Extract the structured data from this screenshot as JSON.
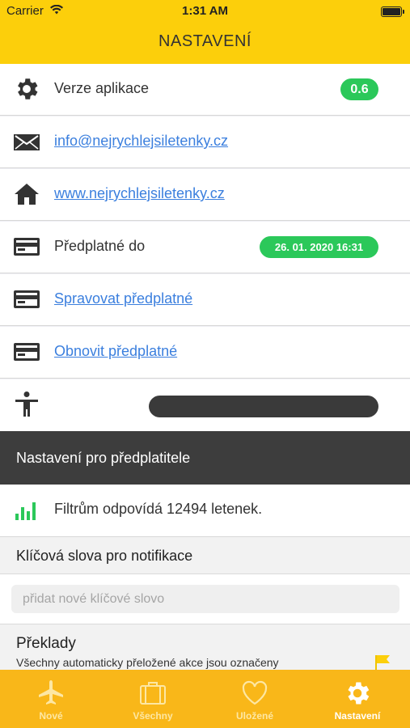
{
  "status_bar": {
    "carrier": "Carrier",
    "time": "1:31 AM"
  },
  "header": {
    "title": "NASTAVENÍ"
  },
  "settings": {
    "version_label": "Verze aplikace",
    "version_value": "0.6",
    "email": "info@nejrychlejsiletenky.cz",
    "website": "www.nejrychlejsiletenky.cz",
    "subscription_label": "Předplatné do",
    "subscription_value": "26. 01. 2020 16:31",
    "manage_subscription": "Spravovat předplatné",
    "restore_subscription": "Obnovit předplatné"
  },
  "subscriber_section": {
    "title": "Nastavení pro předplatitele"
  },
  "filters": {
    "text": "Filtrům odpovídá 12494 letenek."
  },
  "keywords": {
    "title": "Klíčová slova pro notifikace",
    "placeholder": "přidat nové klíčové slovo"
  },
  "translations": {
    "title": "Překlady",
    "description": "Všechny automaticky přeložené akce jsou označeny"
  },
  "tabs": [
    {
      "label": "Nové",
      "icon": "airplane-icon"
    },
    {
      "label": "Všechny",
      "icon": "suitcase-icon"
    },
    {
      "label": "Uložené",
      "icon": "heart-icon"
    },
    {
      "label": "Nastavení",
      "icon": "gear-icon"
    }
  ],
  "colors": {
    "header": "#fccf0b",
    "tabbar": "#f9b719",
    "badge": "#2bc85a",
    "link": "#3b7fde",
    "section_dark": "#3d3d3d"
  }
}
